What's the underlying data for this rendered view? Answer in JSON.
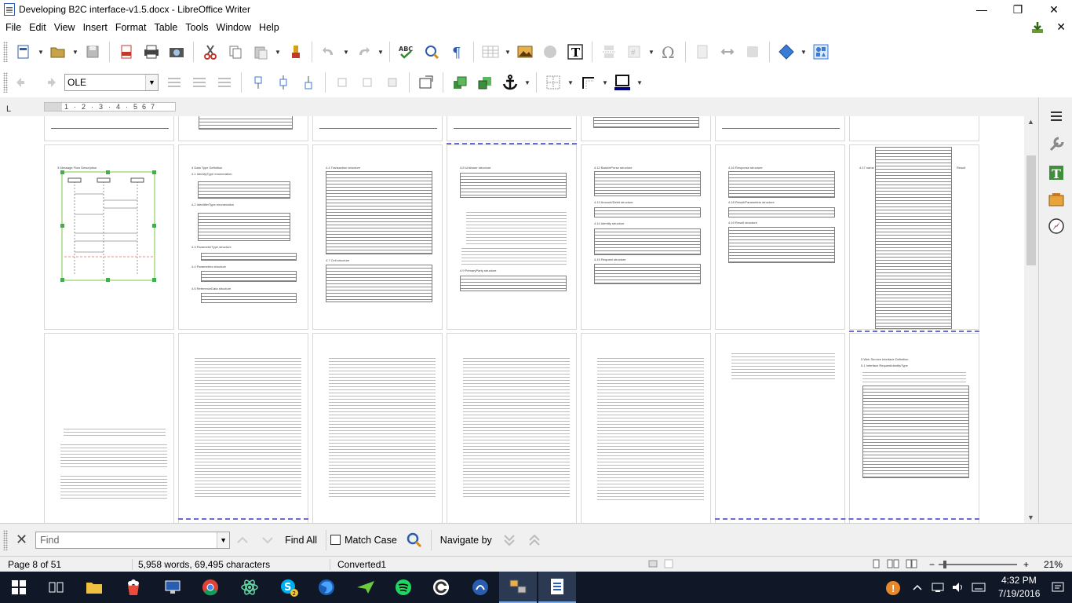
{
  "window": {
    "title": "Developing B2C interface-v1.5.docx - LibreOffice Writer",
    "controls": {
      "minimize": "—",
      "restore": "❐",
      "close": "✕"
    }
  },
  "menu": {
    "items": [
      "File",
      "Edit",
      "View",
      "Insert",
      "Format",
      "Table",
      "Tools",
      "Window",
      "Help"
    ],
    "close_doc": "✕"
  },
  "toolbar2": {
    "frame_style_value": "OLE"
  },
  "ruler": {
    "corner_mark": "L",
    "ticks": [
      "1",
      "2",
      "3",
      "4",
      "5",
      "6",
      "7"
    ]
  },
  "pages": {
    "row2_headings": [
      "3   Message Flow Description",
      "4   Data Type Definition",
      "4.4   Transaction structure",
      "4.8   Unit/user structure",
      "4.12   Bank/ePurse structure",
      "4.16   Response structure",
      "4.17   name"
    ],
    "row2_subheadings": [
      "4.1  IdentityType enumeration",
      "4.2  IdentifierType enumeration",
      "4.3  ParameterType structure",
      "4.4  Parameters structure",
      "4.5  ReferenceData structure",
      "4.7  Cell structure",
      "4.9  PrimaryParty structure",
      "4.13  Amount/Debit structure",
      "4.14  Identity structure",
      "4.15  Request structure",
      "4.18  Result/Parameters structure",
      "4.19  Result structure",
      "Result"
    ],
    "row3_headings": [
      "5   Web Service Interface Definition",
      "5.1   Interface RequestIdentityType"
    ]
  },
  "findbar": {
    "close": "✕",
    "placeholder": "Find",
    "find_all": "Find All",
    "match_case": "Match Case",
    "navigate_by": "Navigate by"
  },
  "status": {
    "page": "Page 8 of 51",
    "words": "5,958 words, 69,495 characters",
    "mode": "Converted1",
    "zoom": "21%",
    "zoom_minus": "−",
    "zoom_plus": "+"
  },
  "taskbar": {
    "time": "4:32 PM",
    "date": "7/19/2016",
    "badge": "2"
  }
}
